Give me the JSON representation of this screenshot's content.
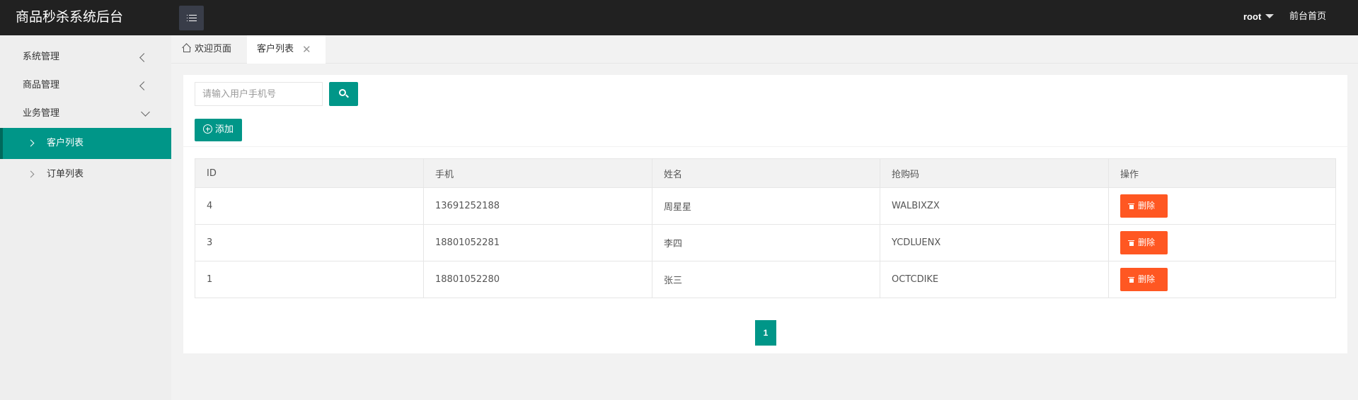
{
  "header": {
    "title": "商品秒杀系统后台",
    "user": "root",
    "front_link": "前台首页"
  },
  "sidebar": {
    "items": [
      {
        "label": "系统管理"
      },
      {
        "label": "商品管理"
      },
      {
        "label": "业务管理"
      }
    ],
    "sub_items": [
      {
        "label": "客户列表",
        "active": true
      },
      {
        "label": "订单列表",
        "active": false
      }
    ]
  },
  "tabs": [
    {
      "label": "欢迎页面",
      "icon": "home-icon"
    },
    {
      "label": "客户列表",
      "active": true,
      "close": "✕"
    }
  ],
  "search": {
    "placeholder": "请输入用户手机号"
  },
  "toolbar": {
    "add_label": "添加"
  },
  "table": {
    "columns": [
      "ID",
      "手机",
      "姓名",
      "抢购码",
      "操作"
    ],
    "rows": [
      {
        "id": "4",
        "phone": "13691252188",
        "name": "周星星",
        "code": "WALBIXZX",
        "action": "删除"
      },
      {
        "id": "3",
        "phone": "18801052281",
        "name": "李四",
        "code": "YCDLUENX",
        "action": "删除"
      },
      {
        "id": "1",
        "phone": "18801052280",
        "name": "张三",
        "code": "OCTCDIKE",
        "action": "删除"
      }
    ]
  },
  "pagination": {
    "current": "1"
  },
  "colors": {
    "primary": "#009688",
    "danger": "#ff5722",
    "header_bg": "#212121"
  }
}
